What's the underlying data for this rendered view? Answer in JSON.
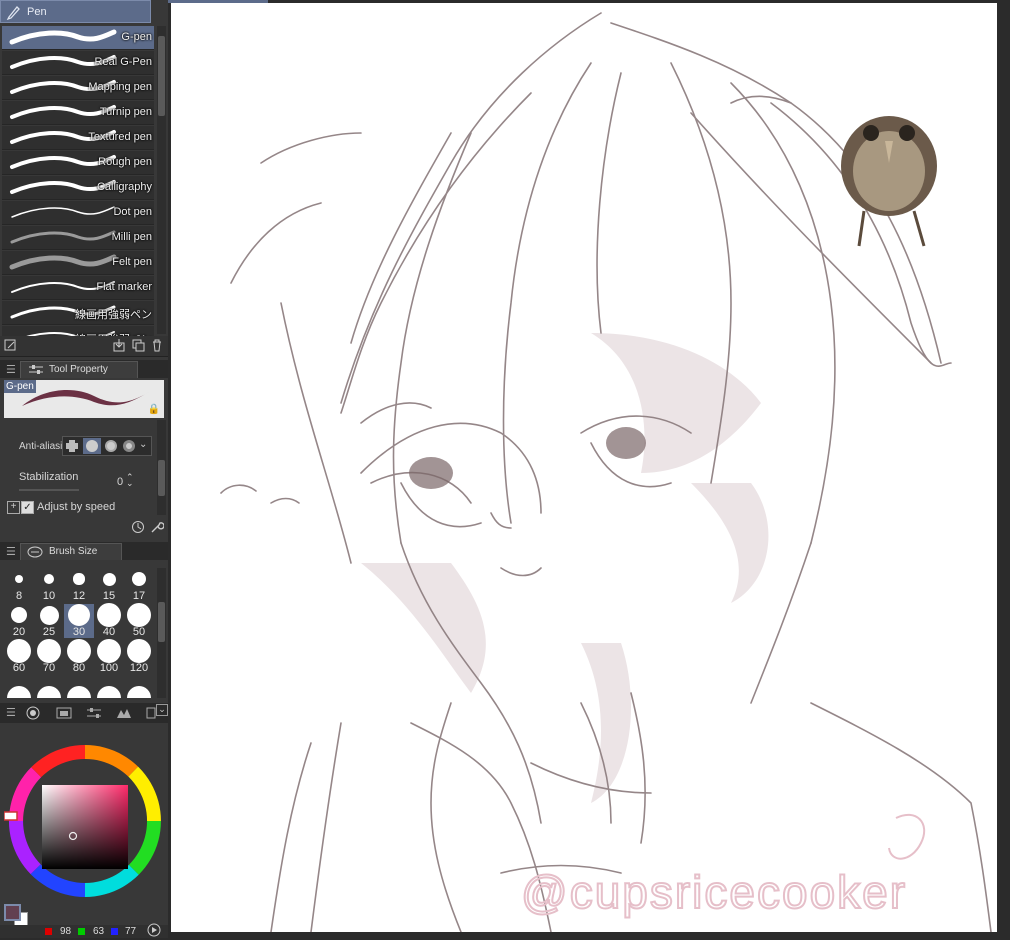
{
  "pen_tab": {
    "label": "Pen",
    "icon": "pen-icon"
  },
  "brushes": [
    {
      "name": "G-pen",
      "selected": true
    },
    {
      "name": "Real G-Pen"
    },
    {
      "name": "Mapping pen"
    },
    {
      "name": "Turnip pen"
    },
    {
      "name": "Textured pen"
    },
    {
      "name": "Rough pen"
    },
    {
      "name": "Calligraphy"
    },
    {
      "name": "Dot pen"
    },
    {
      "name": "Milli pen"
    },
    {
      "name": "Felt pen"
    },
    {
      "name": "Flat marker"
    },
    {
      "name": "線画用強弱ペン"
    },
    {
      "name": "線画用強弱ペン"
    }
  ],
  "tool_property": {
    "tab_label": "Tool Property",
    "preview_label": "G-pen",
    "anti_alias_label": "Anti-aliasi",
    "stabilization_label": "Stabilization",
    "stabilization_value": "0",
    "adjust_by_speed_label": "Adjust by speed",
    "adjust_by_speed_checked": true
  },
  "brush_size": {
    "tab_label": "Brush Size",
    "sizes": [
      "8",
      "10",
      "12",
      "15",
      "17",
      "20",
      "25",
      "30",
      "40",
      "50",
      "60",
      "70",
      "80",
      "100",
      "120"
    ],
    "selected": "30"
  },
  "color": {
    "r": "98",
    "g": "63",
    "b": "77",
    "main_hex": "#624050",
    "hue_hex": "#ff2a6a"
  },
  "watermark": "@cupsricecooker"
}
